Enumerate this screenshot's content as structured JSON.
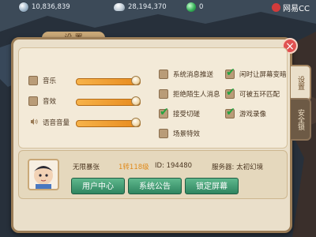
{
  "top": {
    "gold": "10,836,839",
    "silver": "28,194,370",
    "jade": "0",
    "brand": "网易CC"
  },
  "settings_dialog": {
    "title": "设 置",
    "close": "×",
    "tabs": [
      "设置",
      "安全锁"
    ],
    "audio": [
      {
        "label": "音乐",
        "level": 1.0
      },
      {
        "label": "音效",
        "level": 1.0
      },
      {
        "label": "语音音量",
        "level": 1.0
      }
    ],
    "options_left": [
      {
        "label": "系统消息推送",
        "checked": false
      },
      {
        "label": "拒绝陌生人消息",
        "checked": false
      },
      {
        "label": "接受切磋",
        "checked": true
      },
      {
        "label": "场景特效",
        "checked": false
      }
    ],
    "options_right": [
      {
        "label": "闲时让屏幕变暗",
        "checked": true
      },
      {
        "label": "可被五环匹配",
        "checked": true
      },
      {
        "label": "游戏录像",
        "checked": true
      }
    ],
    "user": {
      "name": "无限暴张",
      "level": "1转118级",
      "id": "ID: 194480",
      "server": "服务器: 太初幻境"
    },
    "buttons": [
      "用户中心",
      "系统公告",
      "锁定屏幕"
    ]
  }
}
